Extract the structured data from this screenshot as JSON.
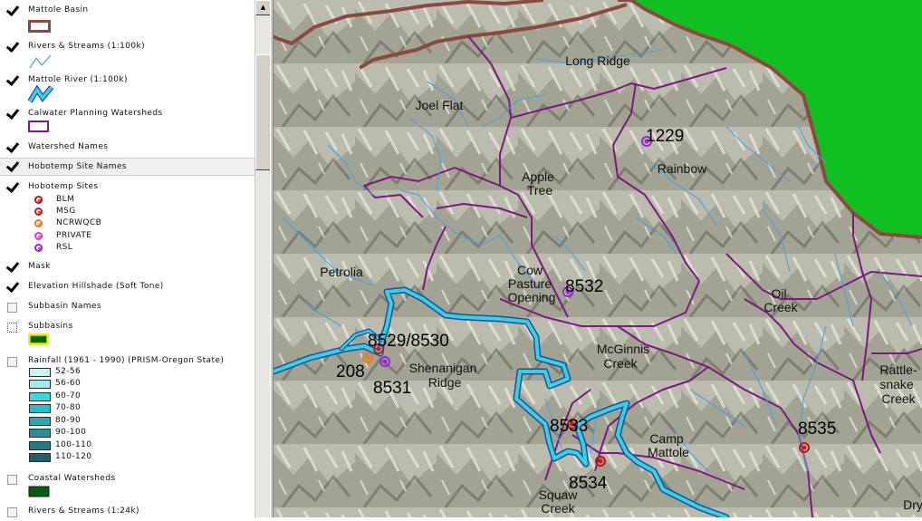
{
  "toc": {
    "layers": [
      {
        "name": "Mattole Basin",
        "checked": true
      },
      {
        "name": "Rivers & Streams (1:100k)",
        "checked": true
      },
      {
        "name": "Mattole River (1:100k)",
        "checked": true
      },
      {
        "name": "Calwater Planning Watersheds",
        "checked": true
      },
      {
        "name": "Watershed Names",
        "checked": true
      },
      {
        "name": "Hobotemp Site Names",
        "checked": true
      },
      {
        "name": "Hobotemp Sites",
        "checked": true
      },
      {
        "name": "Mask",
        "checked": true
      },
      {
        "name": "Elevation Hillshade (Soft Tone)",
        "checked": true
      },
      {
        "name": "Subbasin Names",
        "checked": false
      },
      {
        "name": "Subbasins",
        "checked": false
      },
      {
        "name": "Rainfall (1961 - 1990) (PRISM-Oregon State)",
        "checked": false
      },
      {
        "name": "Coastal Watersheds",
        "checked": false
      },
      {
        "name": "Rivers & Streams (1:24k)",
        "checked": false
      }
    ],
    "site_classes": [
      {
        "label": "BLM",
        "color": "#c01010"
      },
      {
        "label": "MSG",
        "color": "#d01818"
      },
      {
        "label": "NCRWQCB",
        "color": "#f07818"
      },
      {
        "label": "PRIVATE",
        "color": "#e838c8"
      },
      {
        "label": "RSL",
        "color": "#a020e0"
      }
    ],
    "rainfall_classes": [
      {
        "label": "52-56",
        "color": "#c8f4f4"
      },
      {
        "label": "56-60",
        "color": "#a0ecee"
      },
      {
        "label": "60-70",
        "color": "#38d8e0"
      },
      {
        "label": "70-80",
        "color": "#28c0c8"
      },
      {
        "label": "80-90",
        "color": "#2aa8b0"
      },
      {
        "label": "90-100",
        "color": "#2a9098"
      },
      {
        "label": "100-110",
        "color": "#287880"
      },
      {
        "label": "110-120",
        "color": "#226068"
      }
    ]
  },
  "map": {
    "colors": {
      "mask": "#10c020",
      "basin_boundary": "#8b4a40",
      "watershed_line": "#7a1a80",
      "river": "#3ad0e0",
      "river_outline": "#1a50a0",
      "stream": "#4aa0e0",
      "terrain": "#bcbcae"
    },
    "watershed_names": [
      "Long Ridge",
      "Joel Flat",
      "Apple",
      "Tree",
      "Rainbow",
      "Petrolia",
      "Cow",
      "Pasture",
      "Opening",
      "Oil",
      "Creek",
      "McGinnis",
      "Creek",
      "Shenanigan",
      "Ridge",
      "Rattle-",
      "snake",
      "Creek",
      "Camp",
      "Mattole",
      "Squaw",
      "Creek",
      "Dry"
    ],
    "site_names": [
      "1229",
      "8532",
      "8529/8530",
      "208",
      "8531",
      "8533",
      "8534",
      "8535"
    ]
  }
}
